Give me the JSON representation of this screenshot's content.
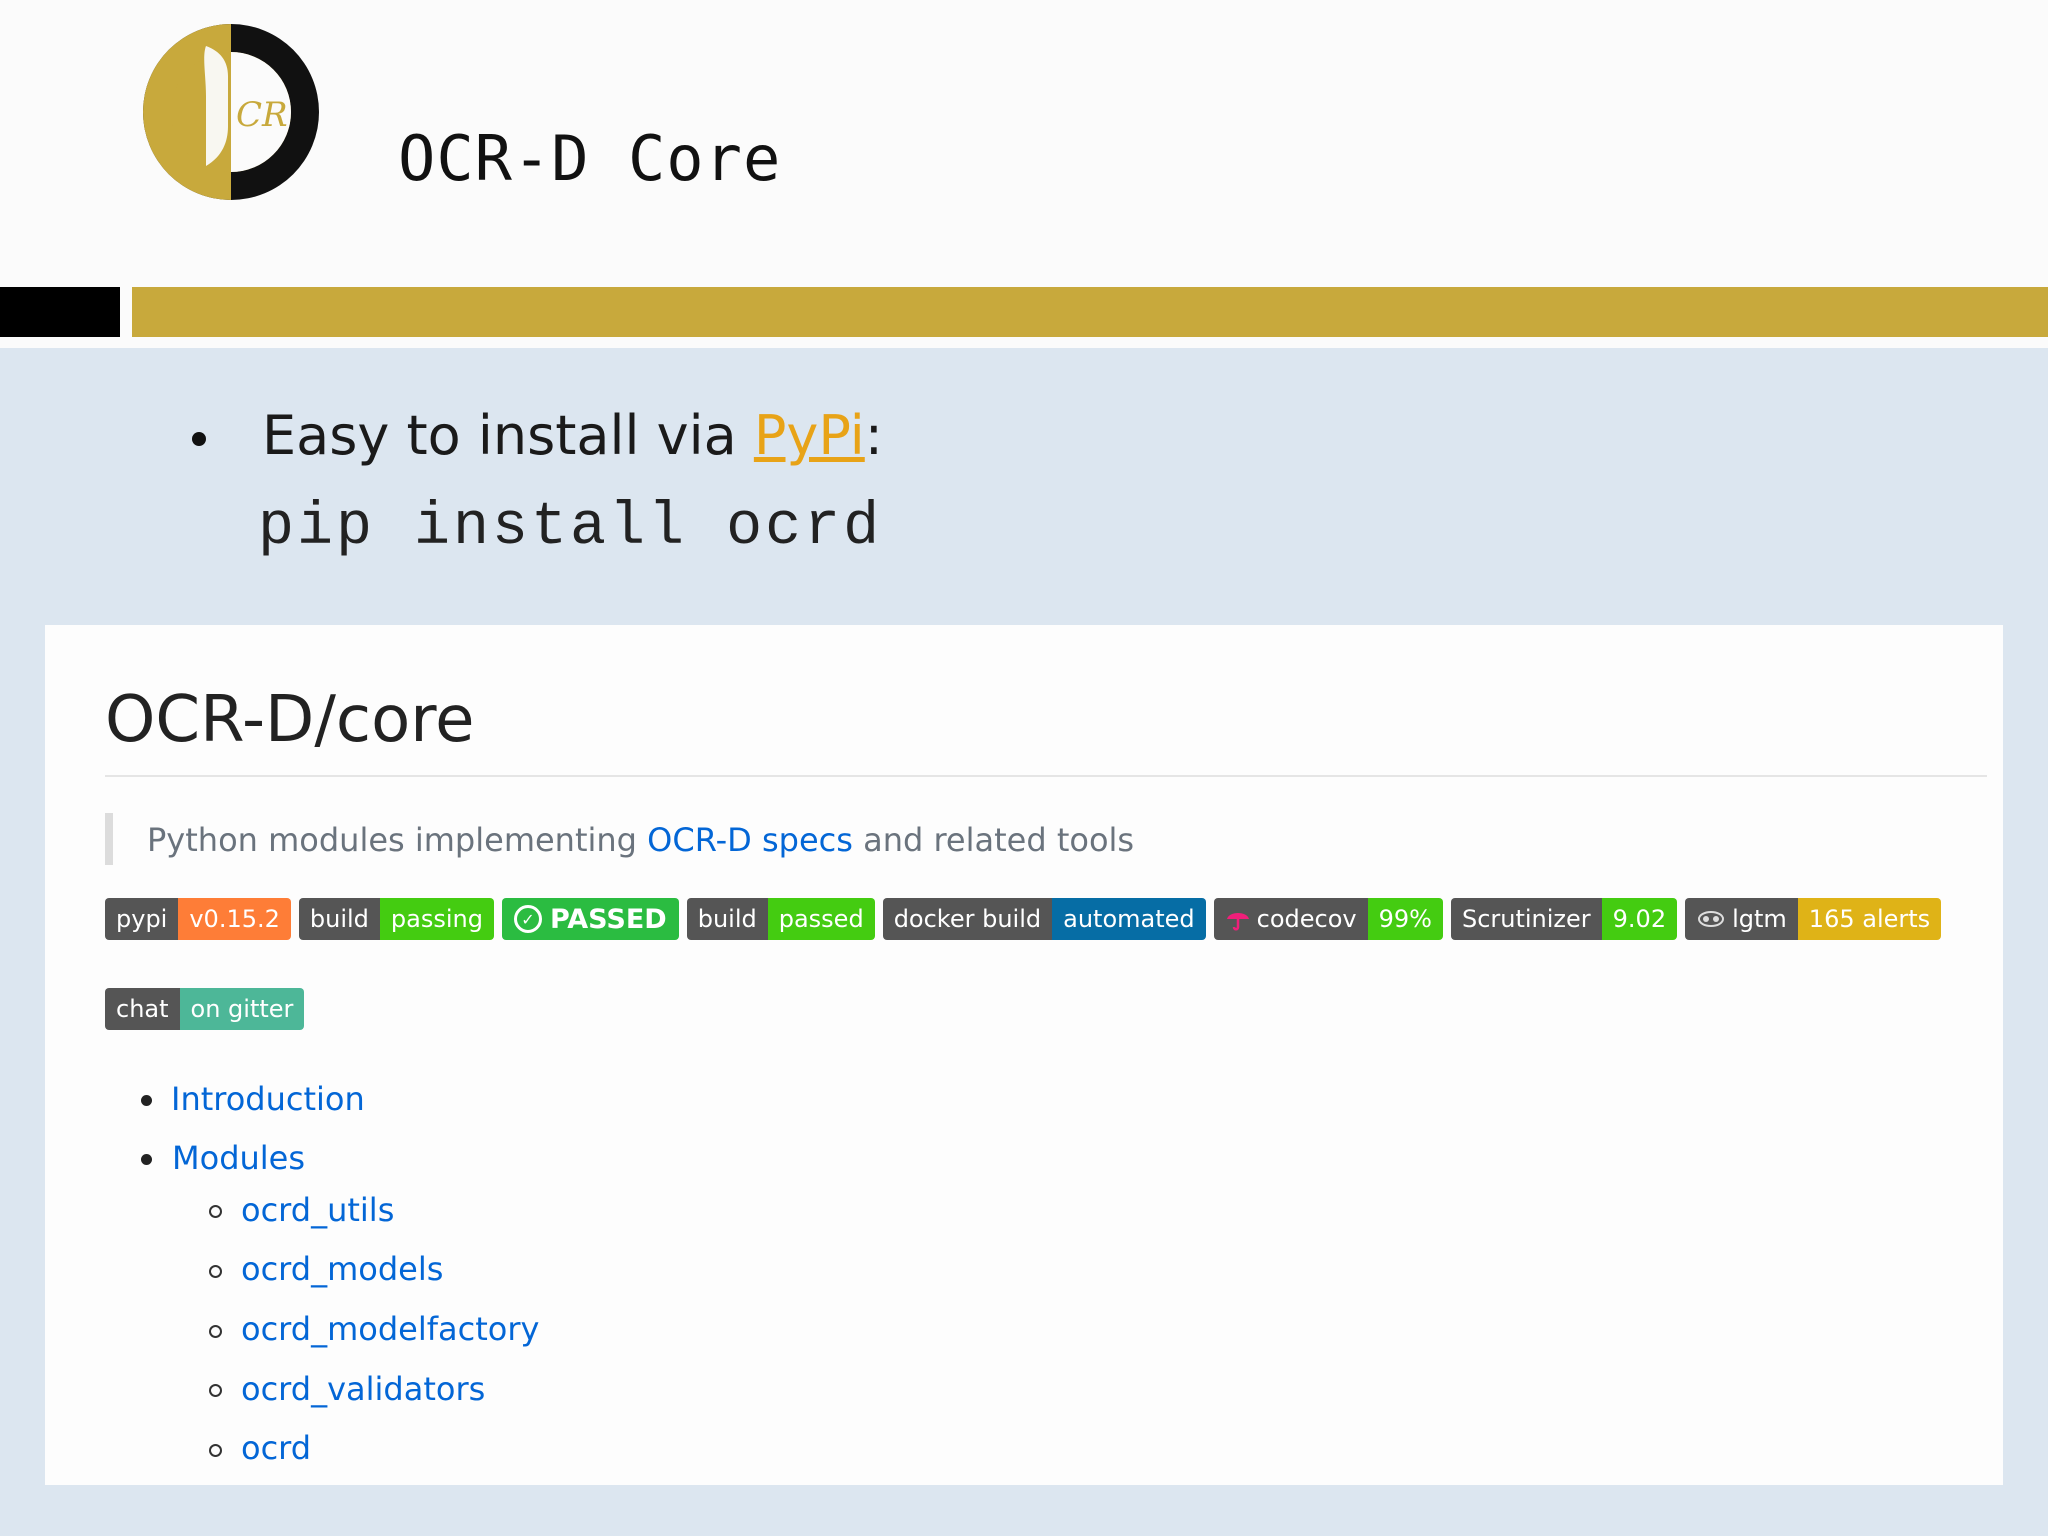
{
  "slide": {
    "title": "OCR-D Core",
    "logo_text": "CR",
    "bullet": {
      "text_before": "Easy to install via ",
      "link_text": "PyPi",
      "text_after": ":"
    },
    "code": "pip install ocrd",
    "colors": {
      "accent_gold": "#c8a93c",
      "black": "#000000",
      "background": "#dce6f0"
    }
  },
  "readme": {
    "title": "OCR-D/core",
    "description": {
      "before": "Python modules implementing ",
      "link": "OCR-D specs",
      "after": " and related tools"
    },
    "badges": [
      {
        "left": "pypi",
        "right": "v0.15.2",
        "color": "#fe7d37"
      },
      {
        "left": "build",
        "right": "passing",
        "color": "#4c1"
      },
      {
        "big": "PASSED",
        "color": "#2bbc41",
        "icon": "check-circle-icon"
      },
      {
        "left": "build",
        "right": "passed",
        "color": "#4c1"
      },
      {
        "left": "docker build",
        "right": "automated",
        "color": "#066da5"
      },
      {
        "left": "codecov",
        "right": "99%",
        "color": "#4c1",
        "icon": "umbrella-icon"
      },
      {
        "left": "Scrutinizer",
        "right": "9.02",
        "color": "#4c1"
      },
      {
        "left": "lgtm",
        "right": "165 alerts",
        "color": "#dfb317",
        "icon": "lgtm-icon"
      }
    ],
    "chat_badge": {
      "left": "chat",
      "right": "on gitter",
      "color": "#4db798"
    },
    "toc": [
      {
        "label": "Introduction",
        "level": 1
      },
      {
        "label": "Modules",
        "level": 1
      },
      {
        "label": "ocrd_utils",
        "level": 2
      },
      {
        "label": "ocrd_models",
        "level": 2
      },
      {
        "label": "ocrd_modelfactory",
        "level": 2
      },
      {
        "label": "ocrd_validators",
        "level": 2
      },
      {
        "label": "ocrd",
        "level": 2
      }
    ]
  }
}
